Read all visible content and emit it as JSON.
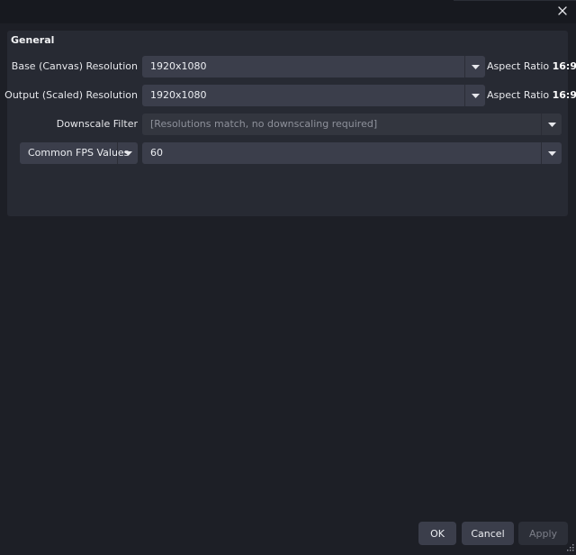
{
  "window": {
    "close_icon": "close-icon"
  },
  "general": {
    "title": "General",
    "base_resolution": {
      "label": "Base (Canvas) Resolution",
      "value": "1920x1080",
      "aspect_prefix": "Aspect Ratio",
      "aspect_value": "16:9"
    },
    "output_resolution": {
      "label": "Output (Scaled) Resolution",
      "value": "1920x1080",
      "aspect_prefix": "Aspect Ratio",
      "aspect_value": "16:9"
    },
    "downscale_filter": {
      "label": "Downscale Filter",
      "value": "[Resolutions match, no downscaling required]"
    },
    "fps": {
      "type_value": "Common FPS Values",
      "value": "60"
    }
  },
  "footer": {
    "ok_label": "OK",
    "cancel_label": "Cancel",
    "apply_label": "Apply"
  },
  "colors": {
    "background": "#1d1f26",
    "panel": "#272a33",
    "control": "#3b3e4b",
    "text": "#e6e7eb",
    "muted_text": "#8e919b"
  }
}
